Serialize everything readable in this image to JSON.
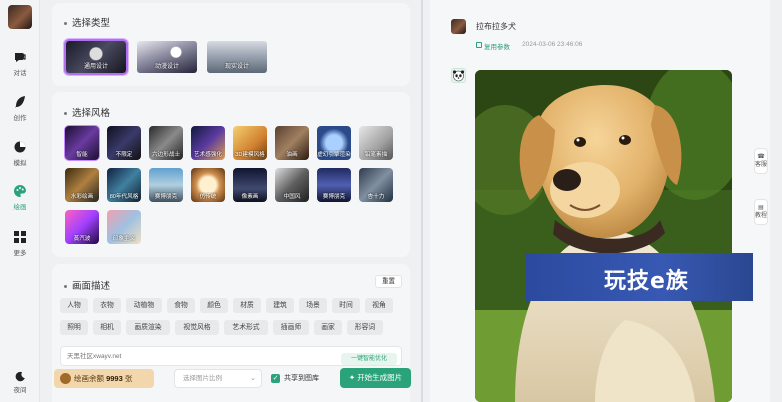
{
  "sidebar": {
    "items": [
      {
        "label": "对话",
        "icon": "chat-icon"
      },
      {
        "label": "创作",
        "icon": "feather-icon"
      },
      {
        "label": "模拟",
        "icon": "chart-icon"
      },
      {
        "label": "绘画",
        "icon": "palette-icon"
      },
      {
        "label": "更多",
        "icon": "grid-icon"
      },
      {
        "label": "夜间",
        "icon": "moon-icon"
      }
    ],
    "active": "绘画",
    "accent": "#2aa37a"
  },
  "type_section": {
    "title": "选择类型",
    "types": [
      "通用设计",
      "动漫设计",
      "现实设计"
    ],
    "selected": "通用设计"
  },
  "style_section": {
    "title": "选择风格",
    "styles": [
      "智能",
      "不限定",
      "六边形战士",
      "艺术感强化",
      "3D建模风格",
      "油画",
      "虚幻引擎渲染",
      "铅笔素描",
      "水彩绘画",
      "80年代风格",
      "赛博朋克",
      "仿传统",
      "像素画",
      "中国风",
      "赛博朋克",
      "杏十力",
      "蒸汽波",
      "印象主义"
    ],
    "selected": "智能"
  },
  "describe_section": {
    "title": "画面描述",
    "reset_label": "重置",
    "tags_row1": [
      "人物",
      "衣物",
      "动植物",
      "食物",
      "颜色",
      "材质",
      "建筑",
      "场景",
      "时间",
      "视角"
    ],
    "tags_row2": [
      "照明",
      "相机",
      "画质渲染",
      "视觉风格",
      "艺术形式",
      "插画师",
      "画家",
      "形容词"
    ],
    "prompt_placeholder": "天黑社区xwayv.net",
    "enhance_label": "一键智能优化"
  },
  "bottom_bar": {
    "credit_label": "绘画余额",
    "credit_value": "9993",
    "credit_unit": "张",
    "size_placeholder": "选择图片比例",
    "share_label": "共享到图库",
    "share_checked": true,
    "generate_label": "开始生成图片"
  },
  "result": {
    "username": "拉布拉多犬",
    "reuse_label": "复用参数",
    "timestamp": "2024-03-06 23:46:06"
  },
  "right_tabs": [
    "客服",
    "教程"
  ],
  "watermark": "玩技e族"
}
